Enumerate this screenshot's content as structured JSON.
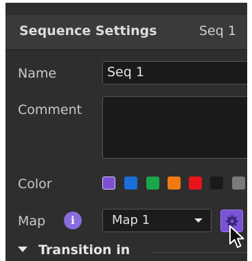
{
  "panel": {
    "title": "Sequence Settings",
    "subtitle": "Seq 1"
  },
  "fields": {
    "name_label": "Name",
    "name_value": "Seq 1",
    "comment_label": "Comment",
    "comment_value": "",
    "color_label": "Color",
    "map_label": "Map",
    "map_value": "Map 1"
  },
  "colors": [
    {
      "name": "purple",
      "hex": "#7f4fd1",
      "selected": true
    },
    {
      "name": "blue",
      "hex": "#1a6fd8"
    },
    {
      "name": "green",
      "hex": "#1aa64c"
    },
    {
      "name": "orange",
      "hex": "#f07a12"
    },
    {
      "name": "red",
      "hex": "#e8141a"
    },
    {
      "name": "black",
      "hex": "#1a1a1a"
    },
    {
      "name": "gray",
      "hex": "#7a7a7a"
    }
  ],
  "icons": {
    "info": "info-icon",
    "map_settings": "gear-icon",
    "dropdown": "chevron-down-icon",
    "section_toggle": "triangle-down-icon",
    "pointer": "mouse-cursor"
  },
  "info_glyph": "i",
  "section": {
    "transition_in": "Transition in"
  },
  "accent": "#7a52d6"
}
